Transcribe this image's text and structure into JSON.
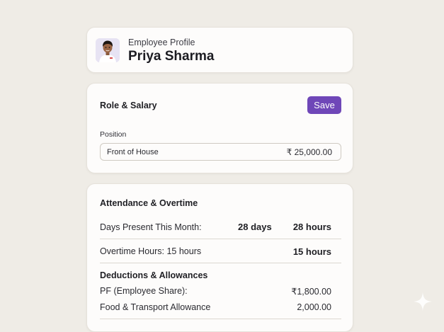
{
  "profile": {
    "kicker": "Employee Profile",
    "name": "Priya Sharma"
  },
  "role": {
    "title": "Role & Salary",
    "save_label": "Save",
    "position_label": "Position",
    "position_value": "Front of House",
    "salary_value": "₹ 25,000.00"
  },
  "attendance": {
    "title": "Attendance & Overtime",
    "days_present_label": "Days Present This Month:",
    "days_present_value": "28 days",
    "days_present_hours": "28 hours",
    "overtime_label": "Overtime Hours: 15 hours",
    "overtime_value": "15 hours"
  },
  "deductions": {
    "title": "Deductions & Allowances",
    "items": [
      {
        "label": "PF (Employee Share):",
        "value": "₹1,800.00"
      },
      {
        "label": "Food & Transport Allowance",
        "value": "2,000.00"
      }
    ]
  },
  "colors": {
    "accent": "#6f47b8",
    "background": "#efece6",
    "card": "#fdfcfb"
  },
  "icons": {
    "avatar": "person-avatar-icon",
    "sparkle": "sparkle-icon"
  }
}
